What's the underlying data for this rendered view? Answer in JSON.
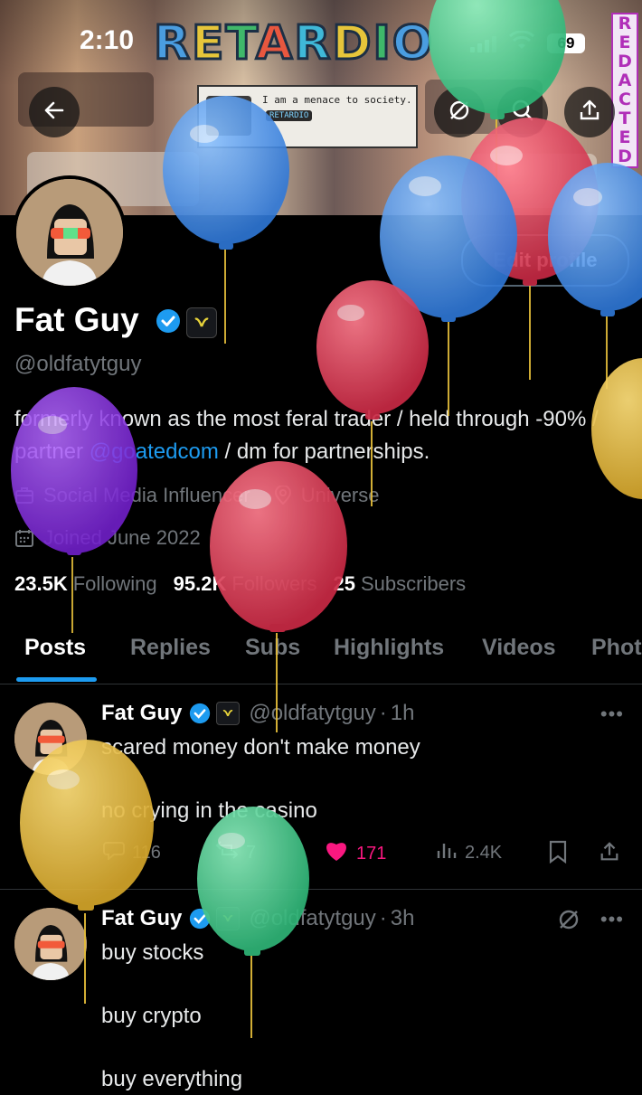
{
  "status_bar": {
    "time": "2:10",
    "battery": "69"
  },
  "banner": {
    "title_letters": [
      "R",
      "E",
      "T",
      "A",
      "R",
      "D",
      "I",
      "O"
    ],
    "card_text": "I am a menace to society.",
    "card_tag": "RETARDIO",
    "redacted_letters": [
      "R",
      "E",
      "D",
      "A",
      "C",
      "T",
      "E",
      "D"
    ]
  },
  "header": {
    "back_icon": "arrow-left-icon",
    "grok_icon": "grok-icon",
    "search_icon": "search-icon",
    "share_icon": "share-icon"
  },
  "profile": {
    "edit_button": "Edit profile",
    "display_name": "Fat Guy",
    "handle": "@oldfatytguy",
    "bio_part1": "formerly known as the most feral trader / held through -90% / partner ",
    "bio_link": "@goatedcom",
    "bio_part2": " / dm for partnerships.",
    "category": "Social Media Influencer",
    "location": "Universe",
    "joined": "Joined June 2022",
    "following_count": "23.5K",
    "following_label": "Following",
    "followers_count": "95.2K",
    "followers_label": "Followers",
    "subscribers_count": "25",
    "subscribers_label": "Subscribers"
  },
  "tabs": [
    "Posts",
    "Replies",
    "Subs",
    "Highlights",
    "Videos",
    "Photos"
  ],
  "posts": [
    {
      "name": "Fat Guy",
      "handle": "@oldfatytguy",
      "time": "1h",
      "text": "scared money don't make money\n\nno crying in the casino",
      "replies": "116",
      "reposts": "7",
      "likes": "171",
      "views": "2.4K"
    },
    {
      "name": "Fat Guy",
      "handle": "@oldfatytguy",
      "time": "3h",
      "text": "buy stocks\n\nbuy crypto\n\nbuy everything"
    }
  ],
  "colors": {
    "accent": "#1d9bf0",
    "like": "#f91880",
    "balloon_blue": "#3f8fe6",
    "balloon_red": "#e0425a",
    "balloon_green": "#43d08a",
    "balloon_yellow": "#e4bd3a",
    "balloon_purple": "#8a2be2"
  }
}
